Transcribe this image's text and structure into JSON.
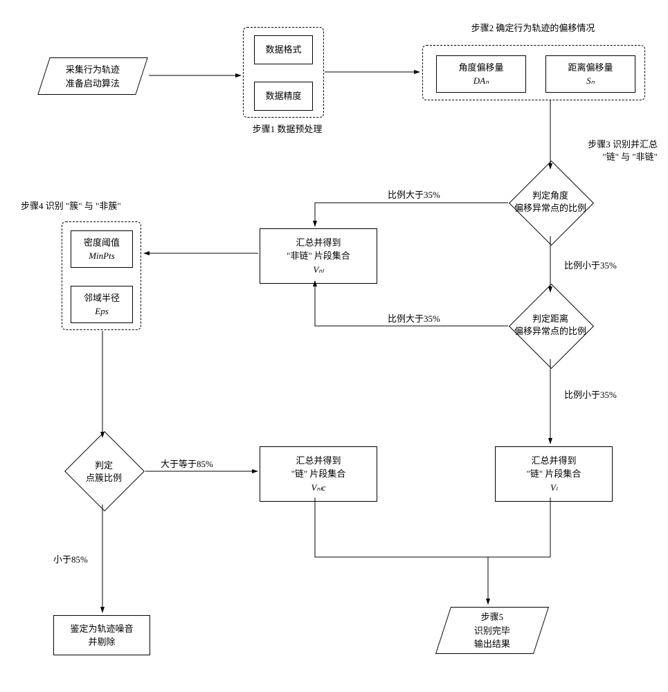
{
  "start": {
    "l1": "采集行为轨迹",
    "l2": "准备启动算法"
  },
  "step1": {
    "title": "步骤1  数据预处理",
    "a": "数据格式",
    "b": "数据精度"
  },
  "step2": {
    "title": "步骤2  确定行为轨迹的偏移情况",
    "a1": "角度偏移量",
    "a2": "DAₙ",
    "b1": "距离偏移量",
    "b2": "Sₙ"
  },
  "step3": {
    "title": "步骤3  识别并汇总",
    "title2": "\"链\" 与 \"非链\"",
    "d1a": "判定角度",
    "d1b": "偏移异常点的比例",
    "d2a": "判定距离",
    "d2b": "偏移异常点的比例",
    "gt": "比例大于35%",
    "lt": "比例小于35%",
    "vnl1": "汇总并得到",
    "vnl2": "\"非链\" 片段集合",
    "vnl3": "Vₙₗ",
    "vl1": "汇总并得到",
    "vl2": "\"链\" 片段集合",
    "vl3": "Vₗ"
  },
  "step4": {
    "title": "步骤4   识别 \"簇\" 与 \"非簇\"",
    "a1": "密度阈值",
    "a2": "MinPts",
    "b1": "邻域半径",
    "b2": "Eps",
    "d1": "判定",
    "d2": "点簇比例",
    "ge": "大于等于85%",
    "lt2": "小于85%",
    "vnlc1": "汇总并得到",
    "vnlc2": "\"链\" 片段集合",
    "vnlc3": "Vₙₗc",
    "noise1": "鉴定为轨迹噪音",
    "noise2": "并剔除"
  },
  "end": {
    "l1": "步骤5",
    "l2": "识别完毕",
    "l3": "输出结果"
  }
}
